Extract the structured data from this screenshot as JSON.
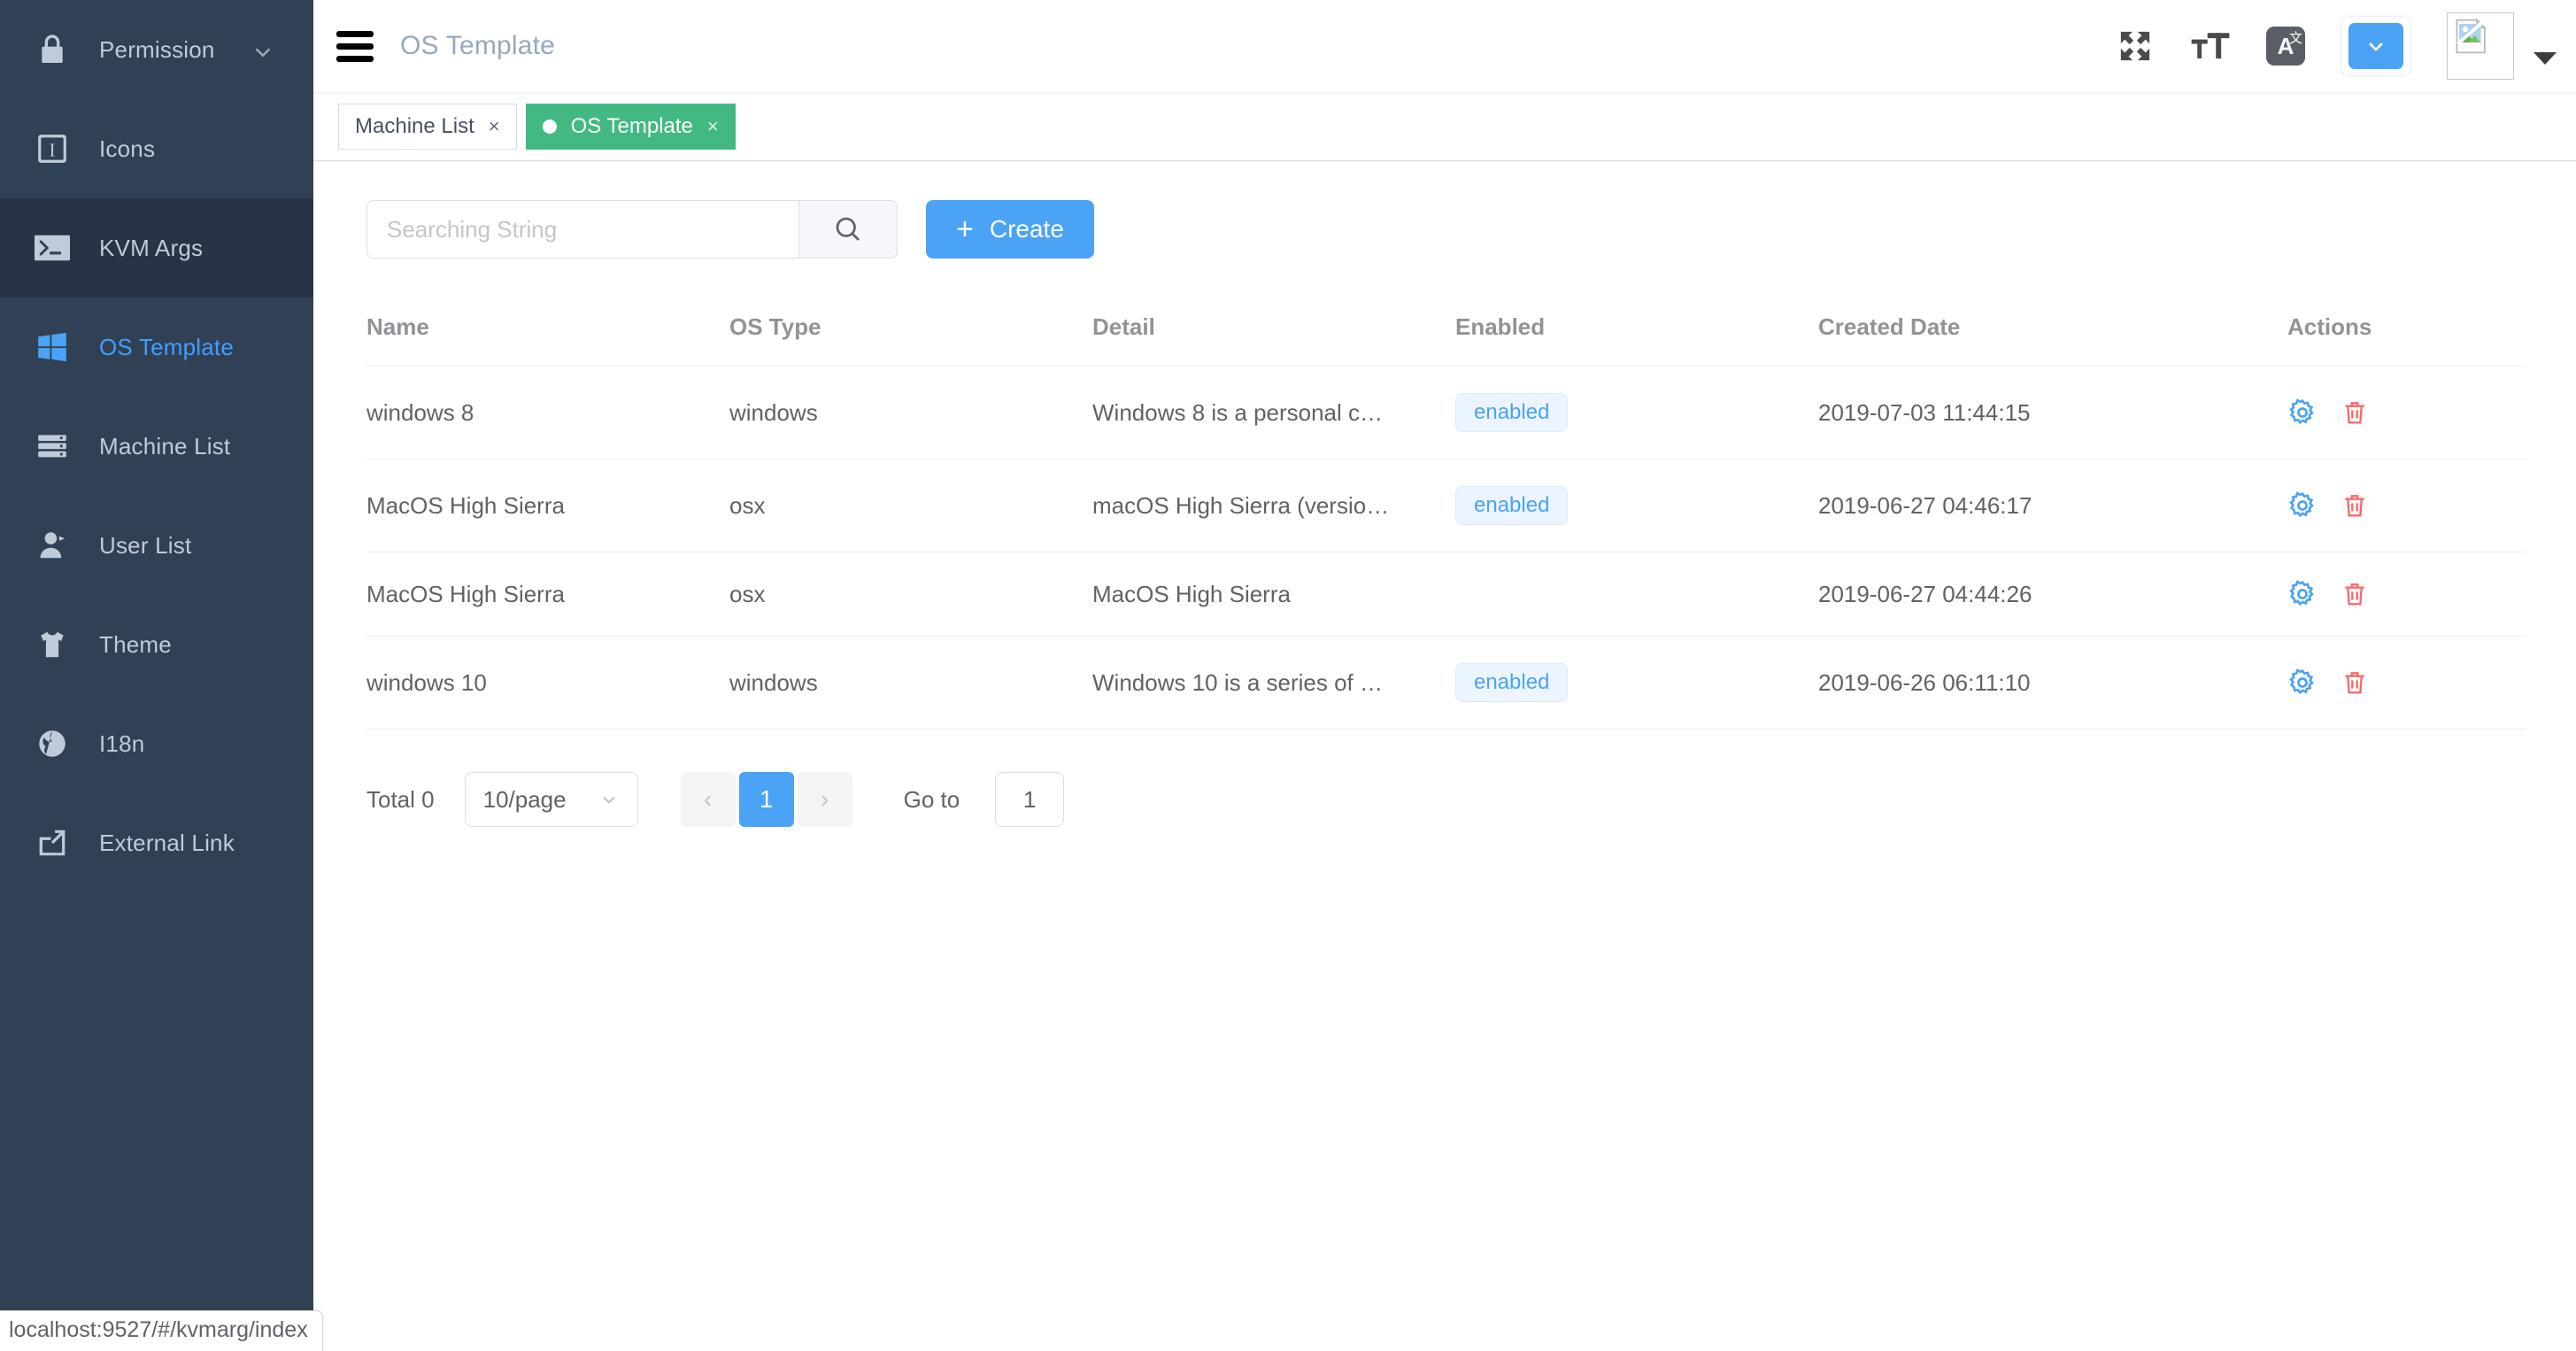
{
  "sidebar": {
    "items": [
      {
        "label": "Permission",
        "icon": "lock-icon",
        "has_chevron": true,
        "state": "normal"
      },
      {
        "label": "Icons",
        "icon": "icons-icon",
        "has_chevron": false,
        "state": "normal"
      },
      {
        "label": "KVM Args",
        "icon": "terminal-icon",
        "has_chevron": false,
        "state": "hovered"
      },
      {
        "label": "OS Template",
        "icon": "windows-icon",
        "has_chevron": false,
        "state": "active"
      },
      {
        "label": "Machine List",
        "icon": "server-icon",
        "has_chevron": false,
        "state": "normal"
      },
      {
        "label": "User List",
        "icon": "user-icon",
        "has_chevron": false,
        "state": "normal"
      },
      {
        "label": "Theme",
        "icon": "tshirt-icon",
        "has_chevron": false,
        "state": "normal"
      },
      {
        "label": "I18n",
        "icon": "globe-icon",
        "has_chevron": false,
        "state": "normal"
      },
      {
        "label": "External Link",
        "icon": "external-link-icon",
        "has_chevron": false,
        "state": "normal"
      }
    ]
  },
  "navbar": {
    "title": "OS Template",
    "icons": {
      "hamburger": "hamburger-icon",
      "fullscreen": "fullscreen-icon",
      "font_size": "font-size-icon",
      "language": "translate-icon",
      "theme_picker": "chevron-down-icon"
    },
    "language_glyph": "A",
    "language_sub_glyph": "文"
  },
  "tabs": [
    {
      "label": "Machine List",
      "active": false,
      "close": "×"
    },
    {
      "label": "OS Template",
      "active": true,
      "close": "×"
    }
  ],
  "toolbar": {
    "search_placeholder": "Searching String",
    "search_value": "",
    "search_icon": "search-icon",
    "create_label": "Create",
    "create_plus": "+"
  },
  "table": {
    "columns": [
      "Name",
      "OS Type",
      "Detail",
      "Enabled",
      "Created Date",
      "Actions"
    ],
    "rows": [
      {
        "name": "windows 8",
        "os_type": "windows",
        "detail": "Windows 8 is a personal c…",
        "enabled": "enabled",
        "created_date": "2019-07-03 11:44:15",
        "edit_icon": "gear-icon",
        "delete_icon": "trash-icon"
      },
      {
        "name": "MacOS High Sierra",
        "os_type": "osx",
        "detail": "macOS High Sierra (versio…",
        "enabled": "enabled",
        "created_date": "2019-06-27 04:46:17",
        "edit_icon": "gear-icon",
        "delete_icon": "trash-icon"
      },
      {
        "name": "MacOS High Sierra",
        "os_type": "osx",
        "detail": "MacOS High Sierra",
        "enabled": "",
        "created_date": "2019-06-27 04:44:26",
        "edit_icon": "gear-icon",
        "delete_icon": "trash-icon"
      },
      {
        "name": "windows 10",
        "os_type": "windows",
        "detail": "Windows 10 is a series of …",
        "enabled": "enabled",
        "created_date": "2019-06-26 06:11:10",
        "edit_icon": "gear-icon",
        "delete_icon": "trash-icon"
      }
    ]
  },
  "pagination": {
    "total_label": "Total 0",
    "page_size": "10/page",
    "prev": "‹",
    "next": "›",
    "current_page": "1",
    "goto_label": "Go to",
    "goto_value": "1"
  },
  "statusbar": {
    "url": "localhost:9527/#/kvmarg/index"
  },
  "colors": {
    "sidebar_bg": "#304156",
    "sidebar_hover": "#263445",
    "accent_blue": "#4aa3f5",
    "tab_active_green": "#42b983",
    "badge_bg": "#ecf5ff",
    "delete_red": "#f56c6c"
  }
}
